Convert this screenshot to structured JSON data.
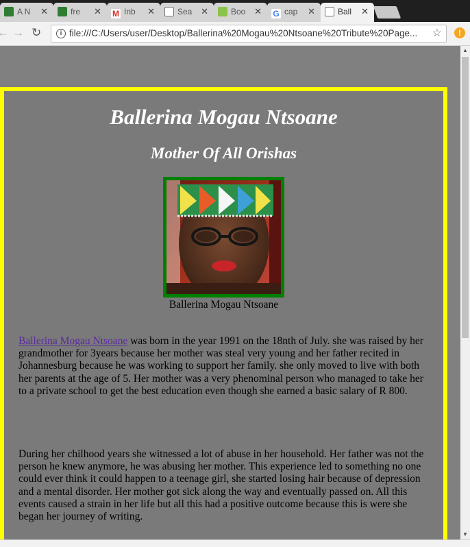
{
  "browser": {
    "tabs": [
      {
        "label": "A N",
        "favicon": "green-app-icon",
        "color": "#2e7d32"
      },
      {
        "label": "fre",
        "favicon": "green-app-icon",
        "color": "#2e7d32"
      },
      {
        "label": "Inb",
        "favicon": "gmail-icon",
        "color": "#d93025"
      },
      {
        "label": "Sea",
        "favicon": "page-icon",
        "color": "#ffffff"
      },
      {
        "label": "Boo",
        "favicon": "w3-icon",
        "color": "#8bc34a"
      },
      {
        "label": "cap",
        "favicon": "google-icon",
        "color": "#4285f4"
      },
      {
        "label": "Ball",
        "favicon": "page-icon",
        "color": "#ffffff",
        "active": true
      }
    ],
    "url": "file:///C:/Users/user/Desktop/Ballerina%20Mogau%20Ntsoane%20Tribute%20Page..."
  },
  "page": {
    "title": "Ballerina Mogau Ntsoane",
    "subtitle": "Mother Of All Orishas",
    "caption": "Ballerina Mogau Ntsoane",
    "paragraph1": {
      "link_text": "Ballerina Mogau Ntsoane",
      "text": " was born in the year 1991 on the 18nth of July. she was raised by her grandmother for 3years because her mother was steal very young and her father recited in Johannesburg because he was working to support her family. she only moved to live with both her parents at the age of 5. Her mother was a very phenominal person who managed to take her to a private school to get the best education even though she earned a basic salary of R 800."
    },
    "paragraph2": "During her chilhood years she witnessed a lot of abuse in her household. Her father was not the person he knew anymore, he was abusing her mother. This experience led to something no one could ever think it could happen to a teenage girl, she started losing hair because of depression and a mental disorder. Her mother got sick along the way and eventually passed on. All this events caused a strain in her life but all this had a positive outcome because this is were she began her journey of writing."
  },
  "colors": {
    "page_background": "#808080",
    "frame_border": "#ffff00",
    "portrait_border": "#008000",
    "link": "#5b2aa0"
  }
}
